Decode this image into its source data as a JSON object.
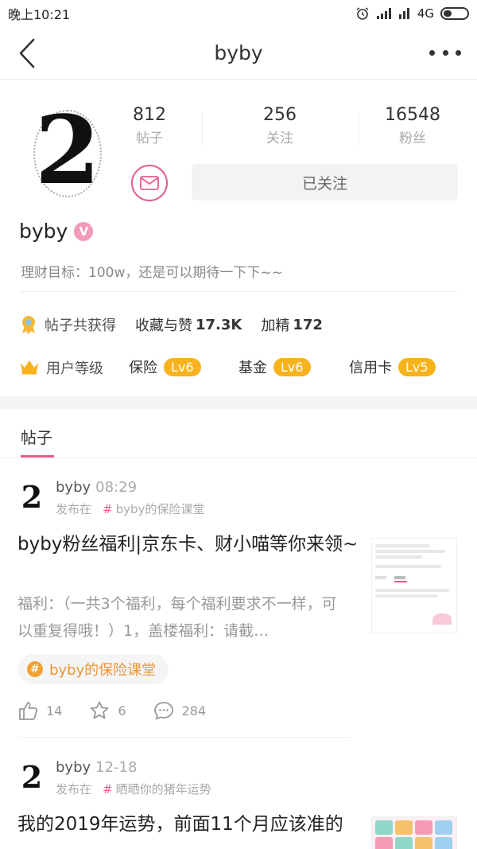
{
  "status_bar": {
    "time": "晚上10:21",
    "network": "4G"
  },
  "nav": {
    "title": "byby"
  },
  "profile": {
    "avatar_char": "2",
    "stats": [
      {
        "value": "812",
        "label": "帖子"
      },
      {
        "value": "256",
        "label": "关注"
      },
      {
        "value": "16548",
        "label": "粉丝"
      }
    ],
    "follow_label": "已关注",
    "name": "byby",
    "verified_badge": "V",
    "bio": "理财目标：100w，还是可以期待一下下~~",
    "awards": {
      "label": "帖子共获得",
      "items": [
        {
          "key": "收藏与赞",
          "value": "17.3K"
        },
        {
          "key": "加精",
          "value": "172"
        }
      ]
    },
    "levels": {
      "label": "用户等级",
      "items": [
        {
          "name": "保险",
          "level": "Lv6"
        },
        {
          "name": "基金",
          "level": "Lv6"
        },
        {
          "name": "信用卡",
          "level": "Lv5"
        }
      ]
    }
  },
  "tabs": {
    "posts": "帖子"
  },
  "posts": [
    {
      "author": "byby",
      "time": "08:29",
      "published_in_label": "发布在",
      "topic": "byby的保险课堂",
      "title": "byby粉丝福利|京东卡、财小喵等你来领~",
      "body": "福利：（一共3个福利，每个福利要求不一样，可以重复得哦！）1，盖楼福利：请截…",
      "tag": "byby的保险课堂",
      "tag_icon": "#",
      "likes": "14",
      "favorites": "6",
      "comments": "284"
    },
    {
      "author": "byby",
      "time": "12-18",
      "published_in_label": "发布在",
      "topic": "晒晒你的猪年运势",
      "title": "我的2019年运势，前面11个月应该准的"
    }
  ],
  "colors": {
    "accent_pink": "#e95b8a",
    "level_orange": "#f7b21d",
    "tag_orange": "#e9973b"
  }
}
